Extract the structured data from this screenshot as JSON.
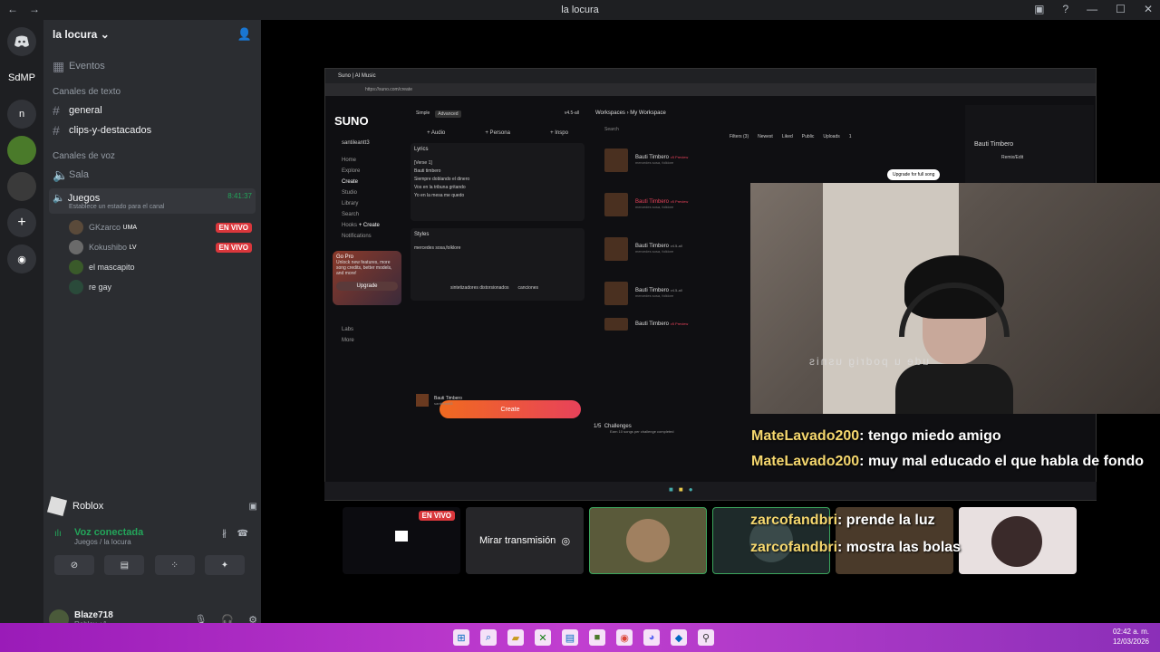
{
  "titlebar": {
    "title": "la locura",
    "back": "←",
    "forward": "→",
    "inbox": "▣",
    "help": "?",
    "min": "—",
    "max": "☐",
    "close": "✕"
  },
  "guilds": {
    "items": [
      "SdMP",
      "n"
    ]
  },
  "server": {
    "name": "la locura",
    "events": "Eventos"
  },
  "channels": {
    "text_category": "Canales de texto",
    "text": [
      "general",
      "clips-y-destacados"
    ],
    "voice_category": "Canales de voz",
    "voice": [
      "Sala",
      "Juegos"
    ],
    "active_voice": {
      "name": "Juegos",
      "timer": "8:41:37",
      "status_placeholder": "Establece un estado para el canal"
    },
    "members": [
      {
        "name": "GKzarco",
        "tag": "UMA",
        "live": "EN VIVO"
      },
      {
        "name": "Kokushibo",
        "tag": "LV",
        "live": "EN VIVO"
      },
      {
        "name": "el mascapito",
        "tag": "",
        "live": ""
      },
      {
        "name": "re gay",
        "tag": "",
        "live": ""
      }
    ]
  },
  "activity": {
    "name": "Roblox"
  },
  "voice_connection": {
    "status": "Voz conectada",
    "location": "Juegos / la locura"
  },
  "user": {
    "name": "Blaze718",
    "sub": "Roblox +1"
  },
  "stream": {
    "browser_tab": "Suno | AI Music",
    "url": "https://suno.com/create",
    "suno": {
      "logo": "SUNO",
      "user": "santileantt3",
      "nav": [
        "Home",
        "Explore",
        "Create",
        "Studio",
        "Library",
        "Search",
        "Hooks",
        "Notifications"
      ],
      "hooks_create": "+ Create",
      "gopro_title": "Go Pro",
      "gopro_desc": "Unlock new features, more song credits, better models, and more!",
      "upgrade": "Upgrade",
      "labs": "Labs",
      "more": "More",
      "mode_tabs": [
        "Simple",
        "Advanced"
      ],
      "version": "v4.5-all",
      "modes": [
        "+ Audio",
        "+ Persona",
        "+ Inspo"
      ],
      "lyrics_label": "Lyrics",
      "lyrics": [
        "[Verse 1]",
        "Bauti timbero",
        "Siempre doblando el dinero",
        "Vos en la tribuna gritando",
        "Yo en la mesa me quedo"
      ],
      "styles_label": "Styles",
      "styles": "mercedes sosa,folklore",
      "style_tags": [
        "sintetizadores distorsionados",
        "canciones"
      ],
      "create": "Create",
      "workspace": [
        "Workspaces",
        "My Workspace"
      ],
      "search": "Search",
      "filters": [
        "Filters (3)",
        "Newest",
        "Liked",
        "Public",
        "Uploads",
        "1"
      ],
      "songs": [
        {
          "title": "Bauti Timbero",
          "badge": "v5 Preview",
          "sub": "mercedes sosa, folklore"
        },
        {
          "title": "Bauti Timbero",
          "badge": "v5 Preview",
          "sub": "mercedes sosa, folklore"
        },
        {
          "title": "Bauti Timbero",
          "badge": "v4.5-all",
          "sub": "mercedes sosa, folklore"
        },
        {
          "title": "Bauti Timbero",
          "badge": "v4.5-all",
          "sub": "mercedes sosa, folklore"
        },
        {
          "title": "Bauti Timbero",
          "badge": "v5 Preview",
          "sub": ""
        }
      ],
      "challenge": "Challenges",
      "challenge_progress": "1/5",
      "challenge_sub": "Earn 10 songs per challenge completed",
      "player_title": "Bauti Timbero",
      "player_user": "santileantt3",
      "right_title": "Bauti Timbero",
      "upgrade_pill": "Upgrade for full song",
      "remix": "Remix/Edit"
    },
    "mirror_text": "ude u podrig usnis"
  },
  "chat": [
    {
      "user": "MateLavado200",
      "msg": ": tengo miedo amigo"
    },
    {
      "user": "MateLavado200",
      "msg": ": muy mal educado el que habla de fondo"
    },
    {
      "user": "zarcofandbri",
      "msg": ": prende la luz"
    },
    {
      "user": "zarcofandbri",
      "msg": ": mostra las bolas"
    }
  ],
  "thumbs": {
    "live": "EN VIVO",
    "watch": "Mirar transmisión"
  },
  "taskbar": {
    "time": "02:42 a. m.",
    "date": "12/03/2026"
  }
}
